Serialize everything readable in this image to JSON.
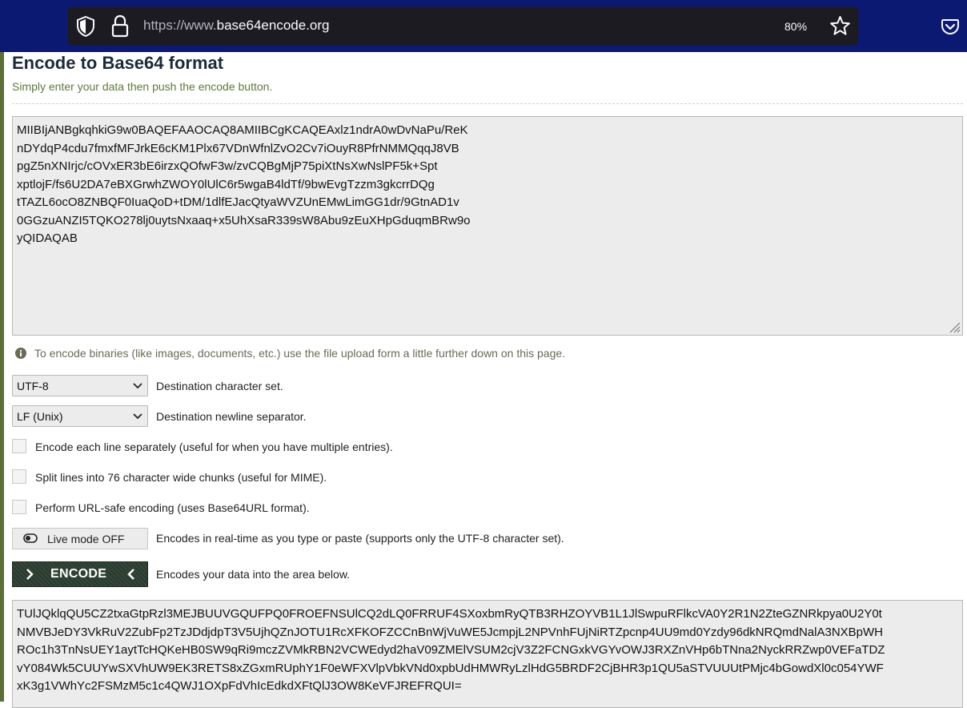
{
  "browser": {
    "url_prefix": "https://www.",
    "url_domain": "base64encode.org",
    "zoom": "80%"
  },
  "page": {
    "title": "Encode to Base64 format",
    "subtitle": "Simply enter your data then push the encode button.",
    "input_text": "MIIBIjANBgkqhkiG9w0BAQEFAAOCAQ8AMIIBCgKCAQEAxlz1ndrA0wDvNaPu/ReK\nnDYdqP4cdu7fmxfMFJrkE6cKM1Plx67VDnWfnlZvO2Cv7iOuyR8PfrNMMQqqJ8VB\npgZ5nXNIrjc/cOVxER3bE6irzxQOfwF3w/zvCQBgMjP75piXtNsXwNslPF5k+Spt\nxptlojF/fs6U2DA7eBXGrwhZWOY0lUlC6r5wgaB4ldTf/9bwEvgTzzm3gkcrrDQg\ntTAZL6ocO8ZNBQF0IuaQoD+tDM/1dlfEJacQtyaWVZUnEMwLimGG1dr/9GtnAD1v\n0GGzuANZI5TQKO278lj0uytsNxaaq+x5UhXsaR339sW8Abu9zEuXHpGduqmBRw9o\nyQIDAQAB",
    "info_text": "To encode binaries (like images, documents, etc.) use the file upload form a little further down on this page.",
    "charset": {
      "value": "UTF-8",
      "label": "Destination character set."
    },
    "newline": {
      "value": "LF (Unix)",
      "label": "Destination newline separator."
    },
    "options": [
      {
        "label": "Encode each line separately (useful for when you have multiple entries).",
        "checked": false
      },
      {
        "label": "Split lines into 76 character wide chunks (useful for MIME).",
        "checked": false
      },
      {
        "label": "Perform URL-safe encoding (uses Base64URL format).",
        "checked": false
      }
    ],
    "live_mode": {
      "label": "Live mode OFF",
      "description": "Encodes in real-time as you type or paste (supports only the UTF-8 character set)."
    },
    "encode": {
      "label": "ENCODE",
      "description": "Encodes your data into the area below."
    },
    "output_text": "TUlJQklqQU5CZ2txaGtpRzl3MEJBUUVGQUFPQ0FROEFNSUlCQ2dLQ0FRRUF4SXoxbmRyQTB3RHZOYVB1L1JlSwpuRFlkcVA0Y2R1N2ZteGZNRkpya0U2Y0t\nNMVBJeDY3VkRuV2ZubFp2TzJDdjdpT3V5UjhQZnJOTU1RcXFKOFZCCnBnWjVuWE5JcmpjL2NPVnhFUjNiRTZpcnp4UU9md0Yzdy96dkNRQmdNalA3NXBpWH\nROc1h3TnNsUEY1aytTcHQKeHB0SW9qRi9mczZVMkRBN2VCWEdyd2haV09ZMElVSUM2cjV3Z2FCNGxkVGYvOWJ3RXZnVHp6bTNna2NyckRRZwp0VEFaTDZ\nvY084Wk5CUUYwSXVhUW9EK3RETS8xZGxmRUphY1F0eWFXVlpVbkVNd0xpbUdHMWRyLzlHdG5BRDF2CjBHR3p1QU5aSTVUUUtPMjc4bGowdXl0c054YWF\nxK3g1VWhYc2FSMzM5c1c4QWJ1OXpFdVhIcEdkdXFtQlJ3OW8KeVFJREFRQUI="
  }
}
